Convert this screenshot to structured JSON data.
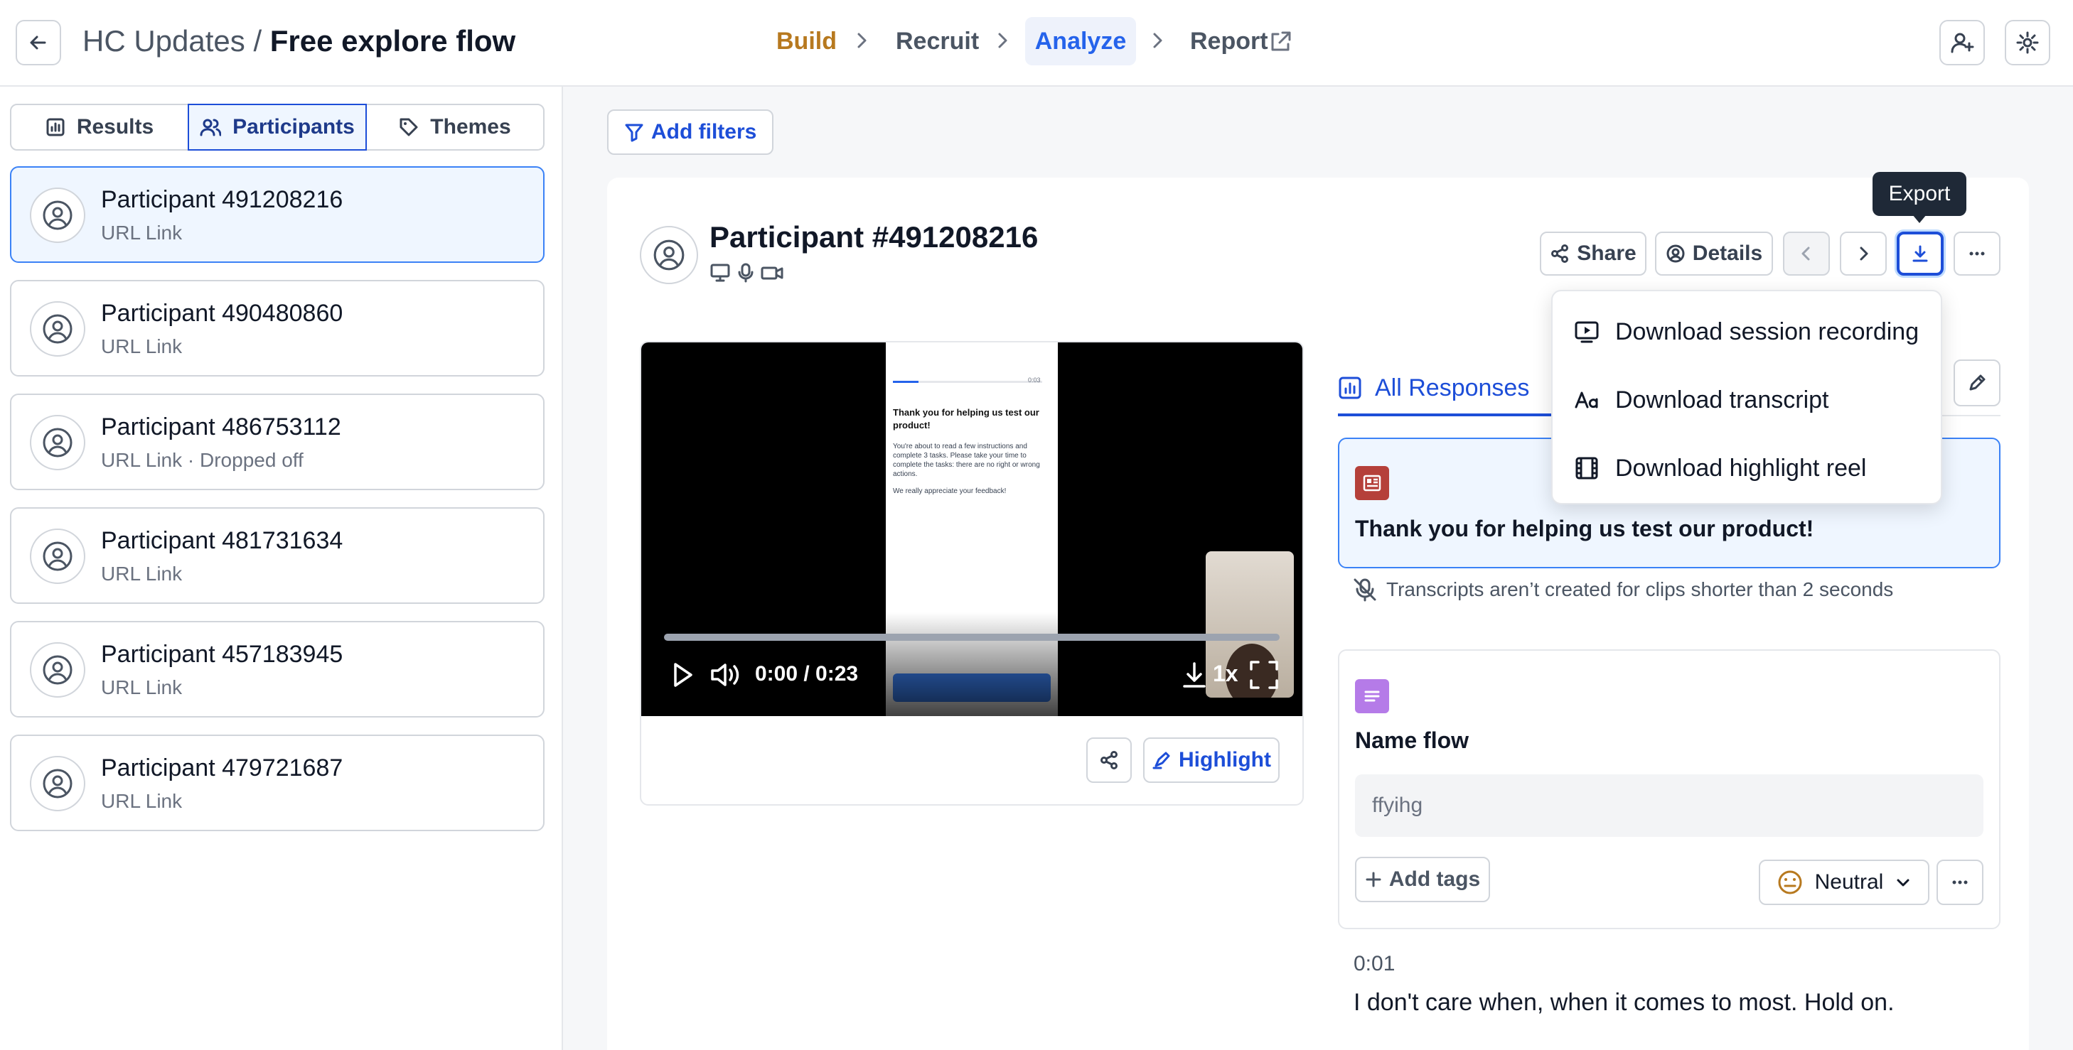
{
  "header": {
    "project": "HC Updates",
    "separator": "/",
    "flow": "Free explore flow",
    "steps": {
      "build": "Build",
      "recruit": "Recruit",
      "analyze": "Analyze",
      "report": "Report"
    }
  },
  "left": {
    "tabs": [
      {
        "label": "Results"
      },
      {
        "label": "Participants"
      },
      {
        "label": "Themes"
      }
    ],
    "active_tab": "Participants",
    "participants": [
      {
        "name": "Participant 491208216",
        "sub": "URL Link"
      },
      {
        "name": "Participant 490480860",
        "sub": "URL Link"
      },
      {
        "name": "Participant 486753112",
        "sub": "URL Link · Dropped off"
      },
      {
        "name": "Participant 481731634",
        "sub": "URL Link"
      },
      {
        "name": "Participant 457183945",
        "sub": "URL Link"
      },
      {
        "name": "Participant 479721687",
        "sub": "URL Link"
      }
    ]
  },
  "main": {
    "add_filters": "Add filters",
    "participant_title": "Participant #491208216",
    "share": "Share",
    "details": "Details",
    "tooltip": "Export",
    "export_menu": [
      {
        "label": "Download session recording",
        "icon": "video-icon"
      },
      {
        "label": "Download transcript",
        "icon": "text-icon"
      },
      {
        "label": "Download highlight reel",
        "icon": "film-icon"
      }
    ],
    "video": {
      "time": "0:00 / 0:23",
      "speed": "1x",
      "progress": 0.0,
      "screen_heading": "Thank you for helping us test our product!",
      "screen_body": "You're about to read a few instructions and complete 3 tasks. Please take your time to complete the tasks: there are no right or wrong actions.",
      "screen_footer": "We really appreciate your feedback!",
      "screen_timer": "0:03"
    },
    "highlight": "Highlight",
    "all_responses": "All Responses",
    "block1": {
      "title": "Thank you for helping us test our product!",
      "note": "Transcripts aren’t created for clips shorter than 2 seconds"
    },
    "block2": {
      "title": "Name flow",
      "answer": "ffyihg",
      "add_tags": "Add tags",
      "sentiment": "Neutral"
    },
    "transcript": {
      "time": "0:01",
      "text": "I don't care when, when it comes to most. Hold on."
    },
    "colors": {
      "accent": "#1d4ed8",
      "build": "#b7791f",
      "block1_icon": "#b5403a",
      "block2_icon": "#b57be8"
    }
  }
}
